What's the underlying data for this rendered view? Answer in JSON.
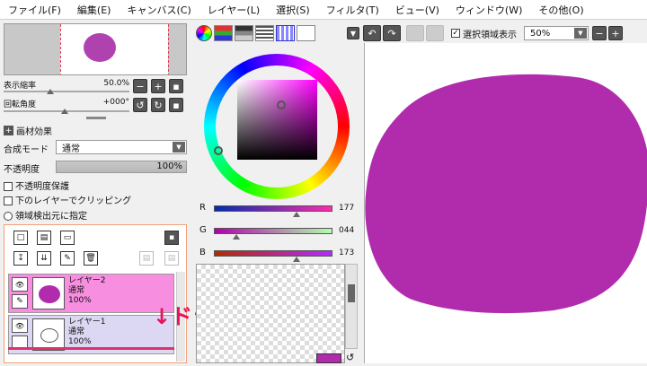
{
  "menu": [
    "ファイル(F)",
    "編集(E)",
    "キャンバス(C)",
    "レイヤー(L)",
    "選択(S)",
    "フィルタ(T)",
    "ビュー(V)",
    "ウィンドウ(W)",
    "その他(O)"
  ],
  "navigator": {
    "zoom_label": "表示縮率",
    "zoom_value": "50.0%",
    "rotation_label": "回転角度",
    "rotation_value": "+000°"
  },
  "layer_settings": {
    "paper_effect": "画材効果",
    "blend_mode_label": "合成モード",
    "blend_mode_value": "通常",
    "opacity_label": "不透明度",
    "opacity_value": "100%",
    "preserve_opacity": "不透明度保護",
    "clipping": "下のレイヤーでクリッピング",
    "selection_source": "領域検出元に指定"
  },
  "layers": [
    {
      "name": "レイヤー2",
      "mode": "通常",
      "opacity": "100%",
      "selected": true
    },
    {
      "name": "レイヤー1",
      "mode": "通常",
      "opacity": "100%",
      "selected": false
    }
  ],
  "annotation": "↓ドラッグ",
  "rgb": {
    "r_label": "R",
    "r_value": "177",
    "g_label": "G",
    "g_value": "044",
    "b_label": "B",
    "b_value": "173"
  },
  "canvas_toolbar": {
    "select_visible_label": "選択領域表示",
    "zoom_value": "50%"
  },
  "colors": {
    "current": "#b12cad",
    "selected_layer_bg": "#f78ee0"
  }
}
